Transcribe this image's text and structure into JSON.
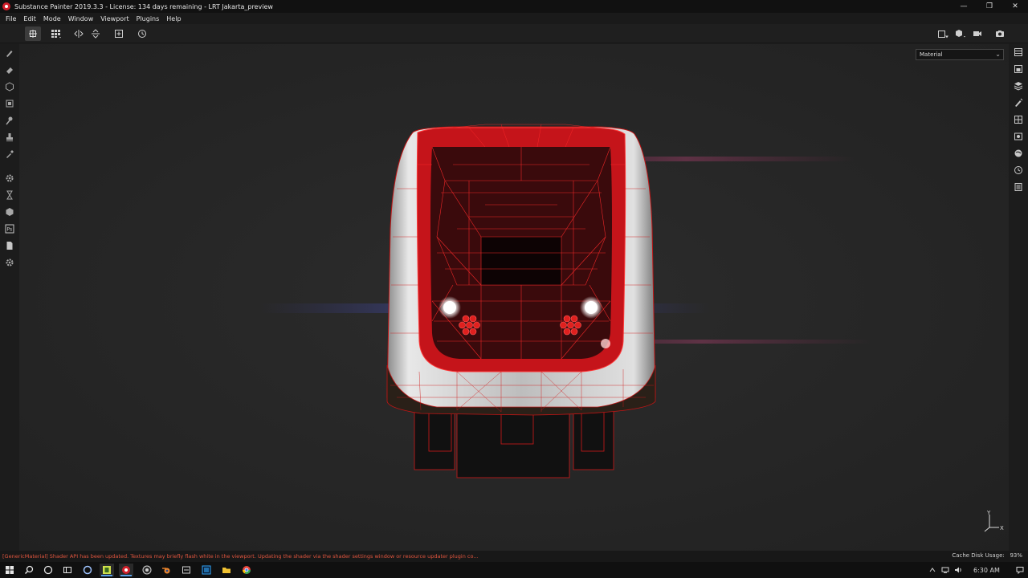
{
  "window": {
    "title": "Substance Painter 2019.3.3 - License: 134 days remaining - LRT Jakarta_preview",
    "minimize_glyph": "—",
    "maximize_glyph": "❐",
    "close_glyph": "✕"
  },
  "menu": [
    "File",
    "Edit",
    "Mode",
    "Window",
    "Viewport",
    "Plugins",
    "Help"
  ],
  "toolbar": {
    "left_icons": [
      "grid-view-icon",
      "grid-dropdown-icon",
      "symmetry-x-icon",
      "symmetry-y-icon",
      "add-frame-icon",
      "reset-view-icon"
    ],
    "right_icons": [
      "view-frame-icon",
      "cube-icon",
      "camera-video-icon",
      "screenshot-icon"
    ]
  },
  "left_tools": [
    "paint-brush-icon",
    "eraser-icon",
    "projection-icon",
    "geometry-mask-icon",
    "smudge-icon",
    "clone-stamp-icon",
    "color-picker-icon",
    "settings-gear-icon",
    "hourglass-icon",
    "bake-icon",
    "photoshop-icon",
    "export-doc-icon",
    "plugin-gear-icon"
  ],
  "right_panels": [
    "layers-stack-icon",
    "texture-set-list-icon",
    "layers-icon",
    "properties-icon",
    "display-settings-icon",
    "shelf-icon",
    "environment-icon",
    "history-icon",
    "log-icon"
  ],
  "viewport": {
    "display_mode": "Material",
    "display_mode_caret": "⌄",
    "axis_labels": {
      "y": "Y",
      "x": "X"
    }
  },
  "status": {
    "message": "[GenericMaterial] Shader API has been updated. Textures may briefly flash white in the viewport. Updating the shader via the shader settings window or resource updater plugin co...",
    "cache_label": "Cache Disk Usage:",
    "cache_value": "93%"
  },
  "taskbar": {
    "apps": [
      "windows-start-icon",
      "search-icon",
      "cortana-icon",
      "task-view-icon",
      "app-3-icon",
      "substance-painter-icon",
      "obs-icon",
      "blender-icon",
      "wacom-icon",
      "photoshop-icon",
      "file-explorer-icon",
      "chrome-icon"
    ],
    "time": "6:30 AM",
    "tray_icons": [
      "chevron-up-icon",
      "network-icon",
      "battery-icon",
      "volume-icon",
      "notification-icon"
    ]
  },
  "colors": {
    "accent_red": "#d11f2a",
    "wireframe_red": "#ff2a2a",
    "status_error": "#e0553e"
  }
}
